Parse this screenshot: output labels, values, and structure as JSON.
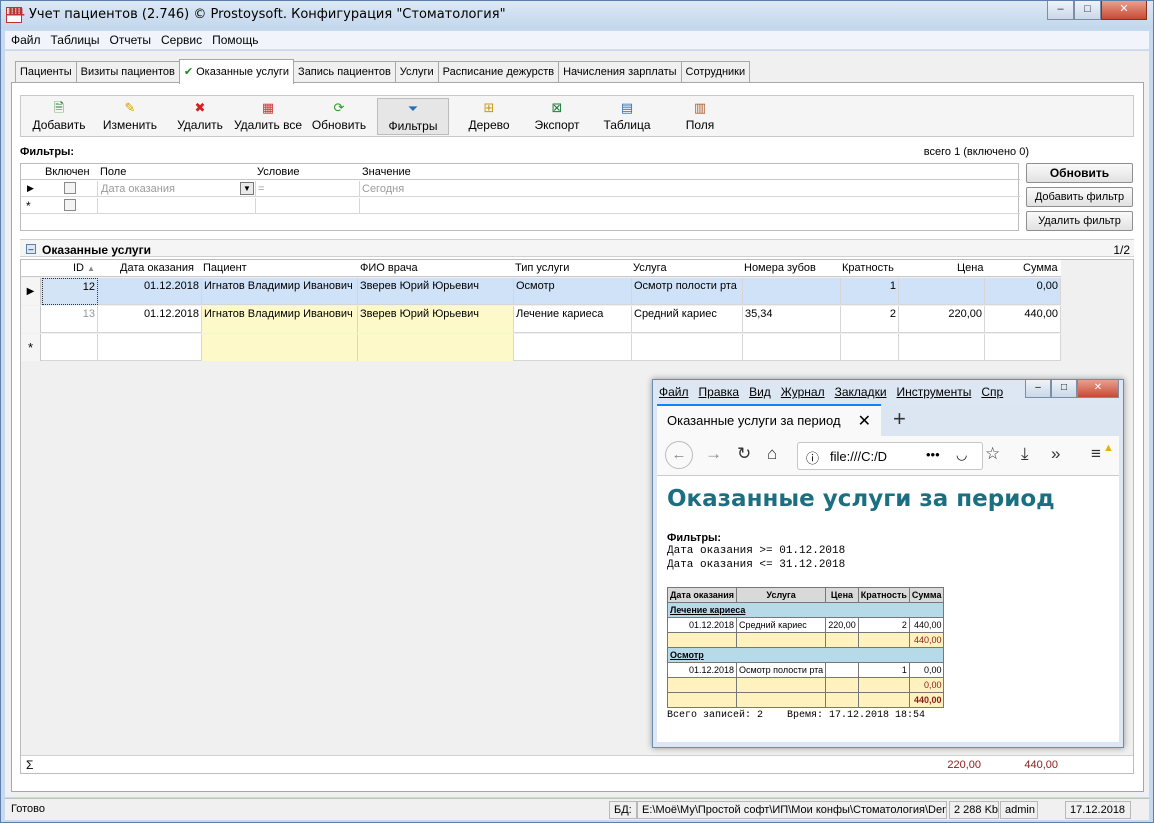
{
  "window": {
    "title": "Учет пациентов (2.746) © Prostoysoft. Конфигурация \"Стоматология\"",
    "buttons": {
      "minimize": "–",
      "maximize": "□",
      "close": "✕"
    }
  },
  "menu": [
    "Файл",
    "Таблицы",
    "Отчеты",
    "Сервис",
    "Помощь"
  ],
  "tabs": [
    {
      "label": "Пациенты"
    },
    {
      "label": "Визиты пациентов"
    },
    {
      "label": "Оказанные услуги",
      "active": true,
      "check": "✔"
    },
    {
      "label": "Запись пациентов"
    },
    {
      "label": "Услуги"
    },
    {
      "label": "Расписание дежурств"
    },
    {
      "label": "Начисления зарплаты"
    },
    {
      "label": "Сотрудники"
    }
  ],
  "toolbar": [
    {
      "label": "Добавить",
      "icon": "add-document-icon"
    },
    {
      "label": "Изменить",
      "icon": "pencil-icon"
    },
    {
      "label": "Удалить",
      "icon": "delete-icon"
    },
    {
      "label": "Удалить все",
      "icon": "delete-all-icon"
    },
    {
      "label": "Обновить",
      "icon": "refresh-icon"
    },
    {
      "label": "Фильтры",
      "icon": "funnel-icon",
      "pressed": true
    },
    {
      "label": "Дерево",
      "icon": "tree-icon"
    },
    {
      "label": "Экспорт",
      "icon": "excel-export-icon"
    },
    {
      "label": "Таблица",
      "icon": "table-icon"
    },
    {
      "label": "Поля",
      "icon": "fields-icon"
    }
  ],
  "filters": {
    "label": "Фильтры:",
    "count": "всего 1 (включено 0)",
    "columns": [
      "Включен",
      "Поле",
      "Условие",
      "Значение"
    ],
    "row": {
      "field": "Дата оказания",
      "condition": "=",
      "value": "Сегодня"
    },
    "buttons": [
      "Обновить",
      "Добавить фильтр",
      "Удалить фильтр"
    ]
  },
  "section": {
    "title": "Оказанные услуги",
    "page": "1/2"
  },
  "grid": {
    "columns": [
      "ID",
      "Дата оказания",
      "Пациент",
      "ФИО врача",
      "Тип услуги",
      "Услуга",
      "Номера зубов",
      "Кратность",
      "Цена",
      "Сумма"
    ],
    "rows": [
      {
        "id": "12",
        "date": "01.12.2018",
        "patient": "Игнатов Владимир Иванович",
        "doctor": "Зверев Юрий Юрьевич",
        "type": "Осмотр",
        "service": "Осмотр полости рта",
        "teeth": "",
        "qty": "1",
        "price": "",
        "sum": "0,00"
      },
      {
        "id": "13",
        "date": "01.12.2018",
        "patient": "Игнатов Владимир Иванович",
        "doctor": "Зверев Юрий Юрьевич",
        "type": "Лечение кариеса",
        "service": "Средний кариес",
        "teeth": "35,34",
        "qty": "2",
        "price": "220,00",
        "sum": "440,00"
      }
    ],
    "sum_symbol": "Σ",
    "totals": {
      "price": "220,00",
      "sum": "440,00"
    }
  },
  "statusbar": {
    "status": "Готово",
    "db_label": "БД:",
    "db_path": "E:\\Моё\\Му\\Простой софт\\ИП\\Мои конфы\\Стоматология\\Dento.mdb",
    "size": "2 288 Kb",
    "user": "admin",
    "date": "17.12.2018"
  },
  "browser": {
    "menu": [
      "Файл",
      "Правка",
      "Вид",
      "Журнал",
      "Закладки",
      "Инструменты",
      "Спр"
    ],
    "tab_title": "Оказанные услуги за период",
    "url": "file:///C:/D",
    "report": {
      "title": "Оказанные услуги за период",
      "filters_label": "Фильтры:",
      "filters": [
        "Дата оказания >= 01.12.2018",
        "Дата оказания <= 31.12.2018"
      ],
      "columns": [
        "Дата оказания",
        "Услуга",
        "Цена",
        "Кратность",
        "Сумма"
      ],
      "groups": [
        {
          "name": "Лечение кариеса",
          "rows": [
            {
              "date": "01.12.2018",
              "service": "Средний кариес",
              "price": "220,00",
              "qty": "2",
              "sum": "440,00"
            }
          ],
          "subtotal": "440,00"
        },
        {
          "name": "Осмотр",
          "rows": [
            {
              "date": "01.12.2018",
              "service": "Осмотр полости рта",
              "price": "",
              "qty": "1",
              "sum": "0,00"
            }
          ],
          "subtotal": "0,00"
        }
      ],
      "total": "440,00",
      "footer": "Всего записей: 2    Время: 17.12.2018 18:54"
    }
  }
}
